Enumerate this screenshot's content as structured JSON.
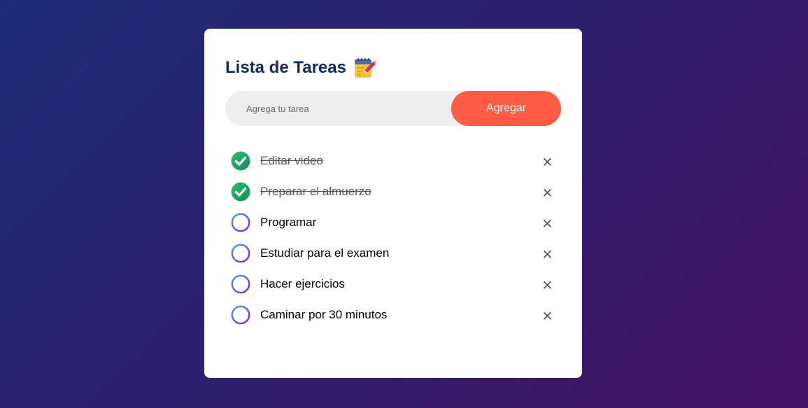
{
  "header": {
    "title": "Lista de Tareas",
    "title_icon": "memo-icon"
  },
  "input": {
    "placeholder": "Agrega tu tarea",
    "value": ""
  },
  "add_button": {
    "label": "Agregar"
  },
  "colors": {
    "title": "#0f2a5f",
    "add_button": "#ff5b45",
    "check_done": "#1fa46a",
    "ring_gradient_start": "#3fa0e8",
    "ring_gradient_end": "#7b1fe0",
    "delete_icon": "#555555"
  },
  "tasks": [
    {
      "text": "Editar video",
      "done": true,
      "status_icon": "check-circle-icon",
      "delete_icon": "close-icon"
    },
    {
      "text": "Preparar el almuerzo",
      "done": true,
      "status_icon": "check-circle-icon",
      "delete_icon": "close-icon"
    },
    {
      "text": "Programar",
      "done": false,
      "status_icon": "empty-circle-icon",
      "delete_icon": "close-icon"
    },
    {
      "text": "Estudiar para el examen",
      "done": false,
      "status_icon": "empty-circle-icon",
      "delete_icon": "close-icon"
    },
    {
      "text": "Hacer ejercicios",
      "done": false,
      "status_icon": "empty-circle-icon",
      "delete_icon": "close-icon"
    },
    {
      "text": "Caminar por 30 minutos",
      "done": false,
      "status_icon": "empty-circle-icon",
      "delete_icon": "close-icon"
    }
  ]
}
